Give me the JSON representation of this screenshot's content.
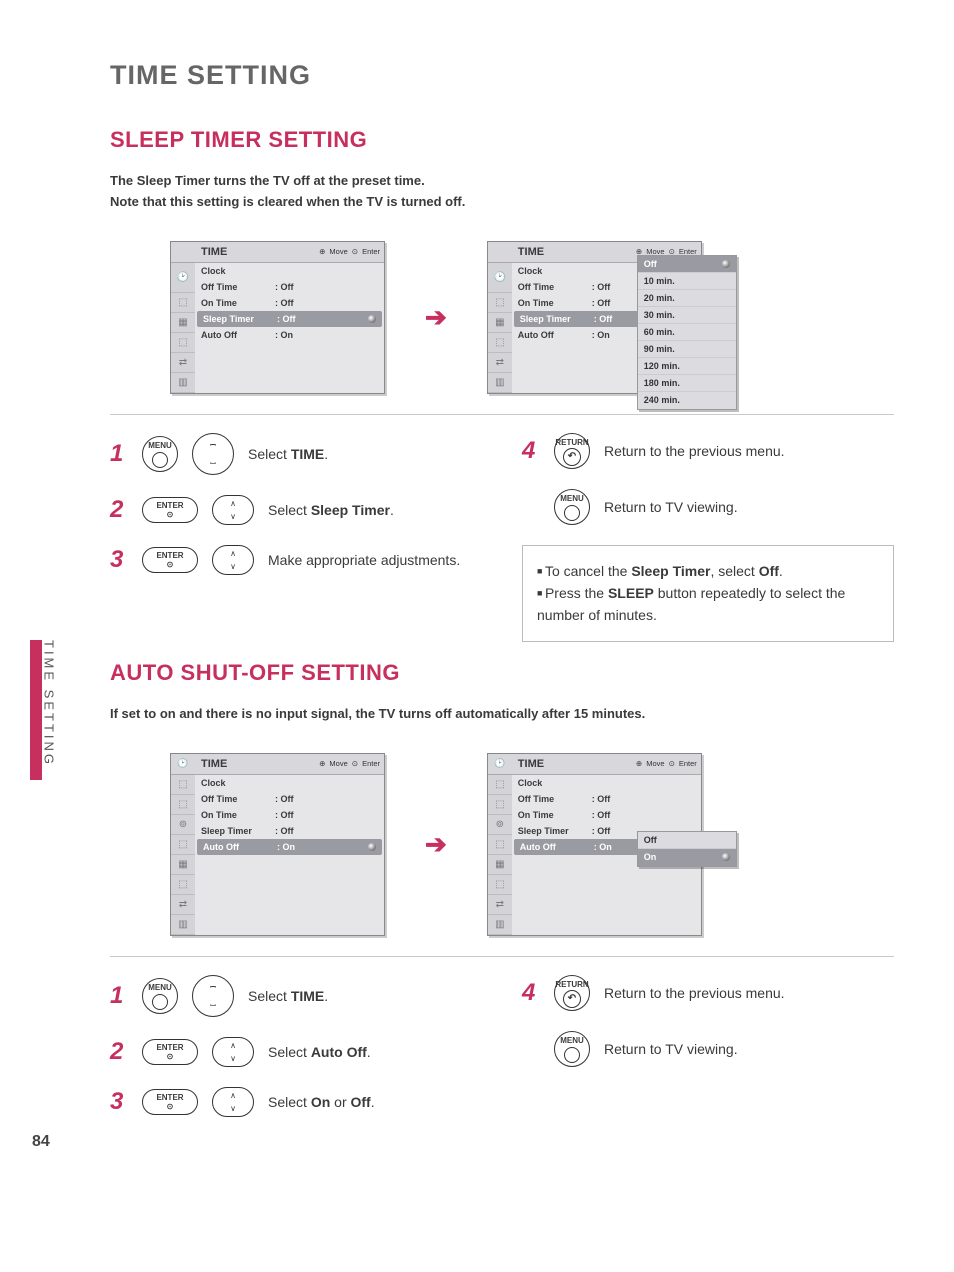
{
  "page_title": "TIME SETTING",
  "side_tab": "TIME SETTING",
  "page_number": "84",
  "section1": {
    "title": "SLEEP TIMER SETTING",
    "intro1": "The Sleep Timer turns the TV off at the preset time.",
    "intro2": "Note that this setting is cleared when the TV is turned off."
  },
  "section2": {
    "title": "AUTO SHUT-OFF SETTING",
    "intro": "If set to on and there is no input signal, the TV turns off automatically after 15 minutes."
  },
  "menu": {
    "header": "TIME",
    "hint_move": "Move",
    "hint_enter": "Enter",
    "rows": {
      "clock": "Clock",
      "off_time": "Off Time",
      "on_time": "On Time",
      "sleep_timer": "Sleep Timer",
      "auto_off": "Auto Off"
    },
    "vals": {
      "off": ": Off",
      "on": ": On"
    }
  },
  "sleep_options": [
    "Off",
    "10 min.",
    "20 min.",
    "30 min.",
    "60 min.",
    "90 min.",
    "120 min.",
    "180 min.",
    "240 min."
  ],
  "auto_options": [
    "Off",
    "On"
  ],
  "buttons": {
    "menu": "MENU",
    "enter": "ENTER",
    "return": "RETURN"
  },
  "steps1": {
    "s1": "Select ",
    "s1b": "TIME",
    "s1c": ".",
    "s2": "Select ",
    "s2b": "Sleep Timer",
    "s2c": ".",
    "s3": "Make appropriate adjustments.",
    "s4": "Return to the previous menu.",
    "s5": "Return to TV viewing."
  },
  "steps2": {
    "s1": "Select ",
    "s1b": "TIME",
    "s1c": ".",
    "s2": "Select ",
    "s2b": "Auto Off",
    "s2c": ".",
    "s3": "Select ",
    "s3b": "On",
    "s3m": " or ",
    "s3b2": "Off",
    "s3c": ".",
    "s4": "Return to the previous menu.",
    "s5": "Return to TV viewing."
  },
  "tips": {
    "t1a": "To cancel the ",
    "t1b": "Sleep Timer",
    "t1c": ", select ",
    "t1d": "Off",
    "t1e": ".",
    "t2a": "Press the ",
    "t2b": "SLEEP",
    "t2c": " button repeatedly to select the number of minutes."
  }
}
